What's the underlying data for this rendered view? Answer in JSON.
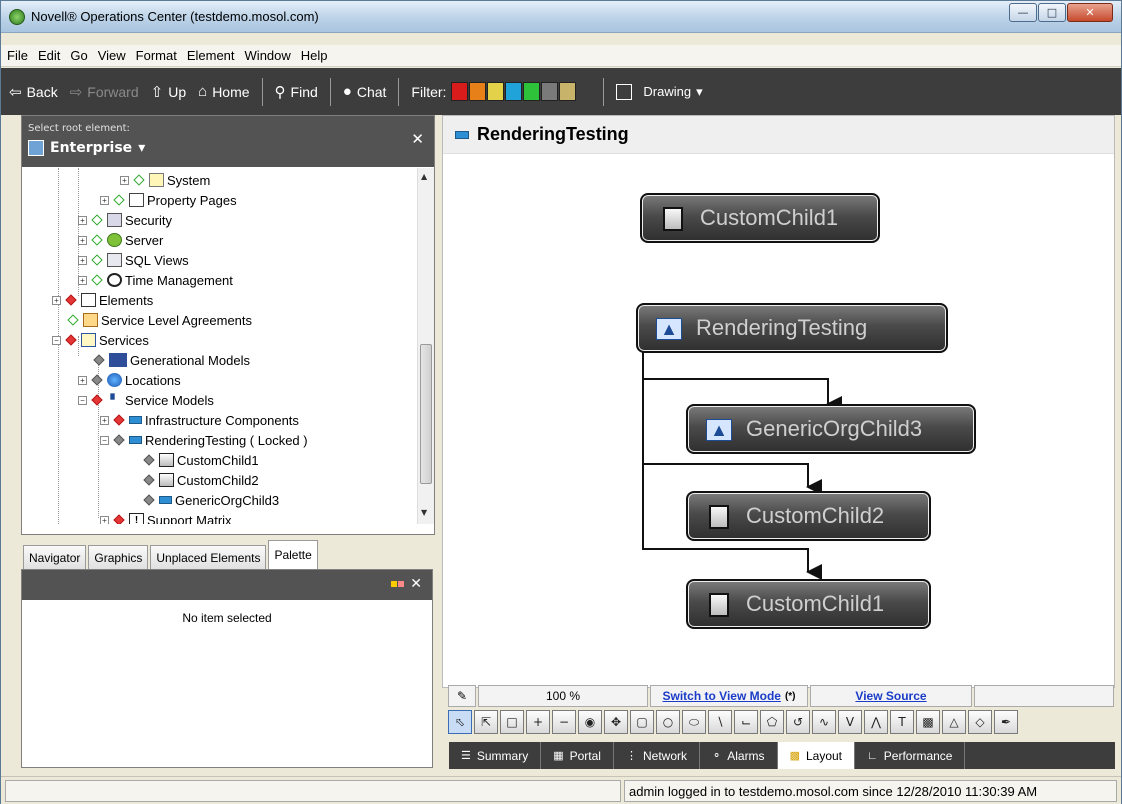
{
  "window": {
    "title": "Novell® Operations Center (testdemo.mosol.com)"
  },
  "menu": [
    "File",
    "Edit",
    "Go",
    "View",
    "Format",
    "Element",
    "Window",
    "Help"
  ],
  "toolbar": {
    "back": "Back",
    "forward": "Forward",
    "up": "Up",
    "home": "Home",
    "find": "Find",
    "chat": "Chat",
    "filter_label": "Filter:",
    "filter_colors": [
      "#d81c1c",
      "#e8801a",
      "#e4d14a",
      "#1fa3d8",
      "#2ec13a",
      "#7a7a7a",
      "#c8b36a"
    ],
    "drawing": "Drawing"
  },
  "left_header": {
    "caption": "Select root element:",
    "root": "Enterprise"
  },
  "tree": [
    {
      "label": "System",
      "icon": "folder"
    },
    {
      "label": "Property Pages",
      "icon": "doc"
    },
    {
      "label": "Security",
      "icon": "lock"
    },
    {
      "label": "Server",
      "icon": "gear"
    },
    {
      "label": "SQL Views",
      "icon": "sql"
    },
    {
      "label": "Time Management",
      "icon": "clock"
    },
    {
      "label": "Elements",
      "icon": "elem"
    },
    {
      "label": "Service Level Agreements",
      "icon": "sla"
    },
    {
      "label": "Services",
      "icon": "svc"
    },
    {
      "label": "Generational Models",
      "icon": "gen"
    },
    {
      "label": "Locations",
      "icon": "globe"
    },
    {
      "label": "Service Models",
      "icon": "org"
    },
    {
      "label": "Infrastructure Components",
      "icon": "blue"
    },
    {
      "label": "RenderingTesting ( Locked )",
      "icon": "blue"
    },
    {
      "label": "CustomChild1",
      "icon": "db"
    },
    {
      "label": "CustomChild2",
      "icon": "db"
    },
    {
      "label": "GenericOrgChild3",
      "icon": "blue"
    },
    {
      "label": "Support Matrix",
      "icon": "excl"
    }
  ],
  "left_tabs": [
    "Navigator",
    "Graphics",
    "Unplaced Elements",
    "Palette"
  ],
  "palette": {
    "empty": "No item selected"
  },
  "view": {
    "title": "RenderingTesting",
    "nodes": [
      "CustomChild1",
      "RenderingTesting",
      "GenericOrgChild3",
      "CustomChild2",
      "CustomChild1"
    ]
  },
  "status": {
    "zoom": "100 %",
    "switch": "Switch to View Mode",
    "switch_suffix": "(*)",
    "source": "View Source"
  },
  "bottom_tabs": [
    "Summary",
    "Portal",
    "Network",
    "Alarms",
    "Layout",
    "Performance"
  ],
  "statusbar": {
    "login": "admin logged in to testdemo.mosol.com since 12/28/2010 11:30:39 AM"
  }
}
